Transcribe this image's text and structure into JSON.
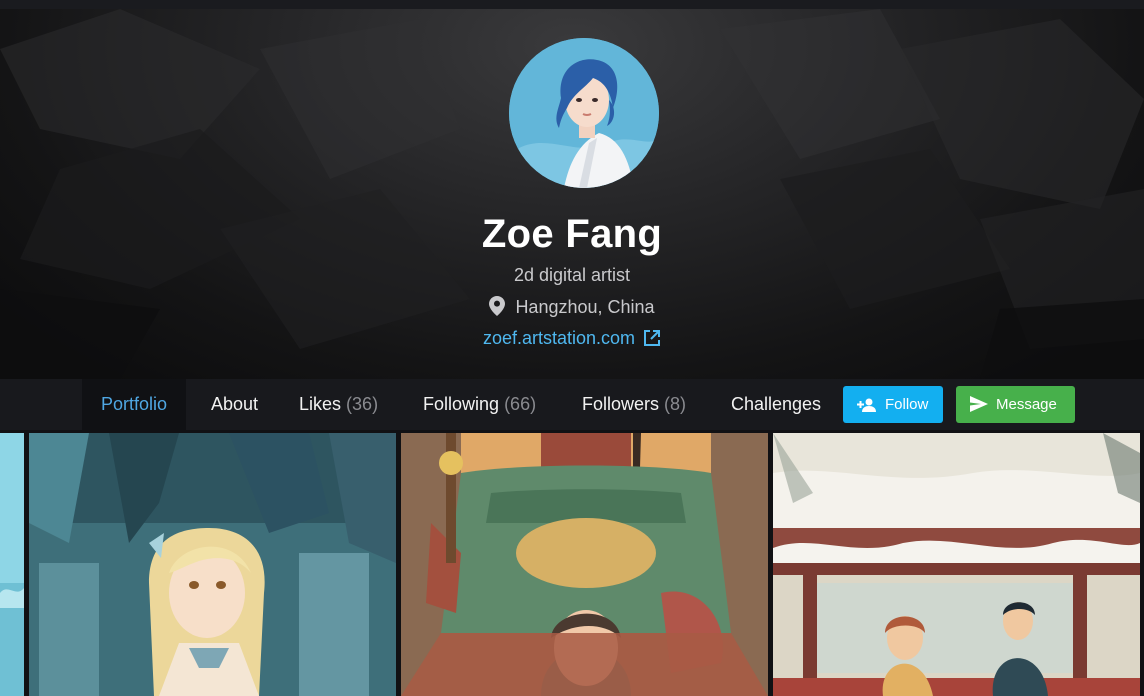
{
  "profile": {
    "name": "Zoe Fang",
    "tagline": "2d digital artist",
    "location": "Hangzhou, China",
    "website": "zoef.artstation.com"
  },
  "icons": {
    "location": "map-pin-icon",
    "website": "external-link-icon",
    "follow": "add-user-icon",
    "message": "send-icon"
  },
  "nav": {
    "tabs": [
      {
        "label": "Portfolio",
        "count": ""
      },
      {
        "label": "About",
        "count": ""
      },
      {
        "label": "Likes",
        "count": "(36)"
      },
      {
        "label": "Following",
        "count": "(66)"
      },
      {
        "label": "Followers",
        "count": "(8)"
      },
      {
        "label": "Challenges",
        "count": ""
      }
    ],
    "follow_label": "Follow",
    "message_label": "Message"
  },
  "colors": {
    "accent_link": "#4fb8f0",
    "active_tab": "#4fa7e3",
    "follow_button": "#13aff0",
    "message_button": "#47b04b"
  }
}
